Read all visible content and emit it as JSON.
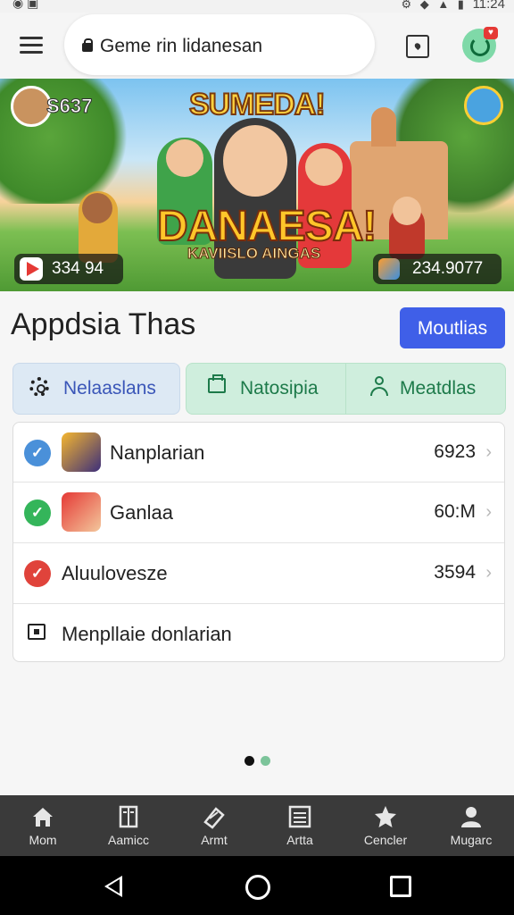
{
  "status_bar": {
    "time": "11:24"
  },
  "search": {
    "text": "Geme rin lidanesan"
  },
  "banner": {
    "score_left": "S637",
    "title": "SUMEDA!",
    "big_title": "DANAESA!",
    "subtitle": "KAVIISLO AINGAS",
    "counter_left": "334 94",
    "counter_right": "234.9077"
  },
  "section": {
    "title": "Appdsia Thas",
    "action_label": "Moutlias"
  },
  "tabs": [
    {
      "label": "Nelaaslans",
      "icon": "gear-icon"
    },
    {
      "label": "Natosipia",
      "icon": "folder-icon"
    },
    {
      "label": "Meatdlas",
      "icon": "person-icon"
    }
  ],
  "list": [
    {
      "label": "Nanplarian",
      "value": "6923",
      "status_color": "#4a90d9"
    },
    {
      "label": "Ganlaa",
      "value": "60:M",
      "status_color": "#34b55a"
    },
    {
      "label": "Aluulovesze",
      "value": "3594",
      "status_color": "#e0433b"
    },
    {
      "label": "Menpllaie donlarian",
      "value": ""
    }
  ],
  "pager": {
    "active_color": "#111111",
    "inactive_color": "#7cc49a"
  },
  "bottom_nav": [
    {
      "label": "Mom",
      "icon": "home-icon"
    },
    {
      "label": "Aamicc",
      "icon": "book-icon"
    },
    {
      "label": "Armt",
      "icon": "tag-icon"
    },
    {
      "label": "Artta",
      "icon": "list-icon"
    },
    {
      "label": "Cencler",
      "icon": "star-icon"
    },
    {
      "label": "Mugarc",
      "icon": "person-icon"
    }
  ],
  "colors": {
    "accent": "#3f5fe8",
    "nav_bg": "#3a3a3a"
  }
}
